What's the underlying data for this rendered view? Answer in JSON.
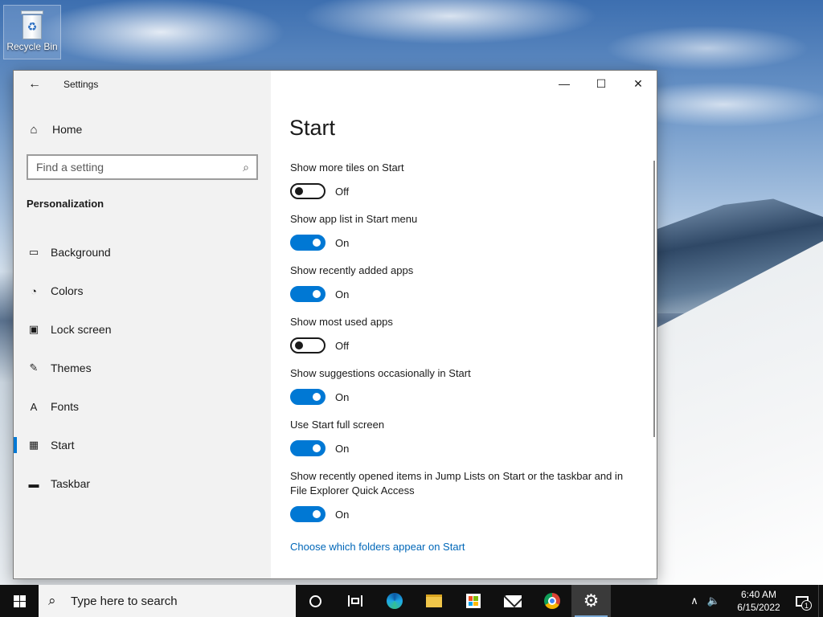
{
  "desktop": {
    "icons": [
      {
        "label": "Recycle Bin",
        "icon": "recycle-bin-icon"
      }
    ]
  },
  "window": {
    "app_title": "Settings",
    "caption": {
      "minimize": "—",
      "maximize": "☐",
      "close": "✕"
    },
    "sidebar": {
      "home_label": "Home",
      "search_placeholder": "Find a setting",
      "section_title": "Personalization",
      "items": [
        {
          "label": "Background",
          "icon": "background-icon",
          "glyph": "▭"
        },
        {
          "label": "Colors",
          "icon": "palette-icon",
          "glyph": "◔"
        },
        {
          "label": "Lock screen",
          "icon": "lock-screen-icon",
          "glyph": "▣"
        },
        {
          "label": "Themes",
          "icon": "themes-icon",
          "glyph": "✎"
        },
        {
          "label": "Fonts",
          "icon": "fonts-icon",
          "glyph": "A"
        },
        {
          "label": "Start",
          "icon": "start-icon",
          "glyph": "▦"
        },
        {
          "label": "Taskbar",
          "icon": "taskbar-icon",
          "glyph": "▬"
        }
      ],
      "active_item": "Start"
    },
    "content": {
      "title": "Start",
      "settings": [
        {
          "label": "Show more tiles on Start",
          "on": false,
          "state": "Off"
        },
        {
          "label": "Show app list in Start menu",
          "on": true,
          "state": "On"
        },
        {
          "label": "Show recently added apps",
          "on": true,
          "state": "On"
        },
        {
          "label": "Show most used apps",
          "on": false,
          "state": "Off"
        },
        {
          "label": "Show suggestions occasionally in Start",
          "on": true,
          "state": "On"
        },
        {
          "label": "Use Start full screen",
          "on": true,
          "state": "On"
        },
        {
          "label": "Show recently opened items in Jump Lists on Start or the taskbar and in File Explorer Quick Access",
          "on": true,
          "state": "On"
        }
      ],
      "link": "Choose which folders appear on Start"
    }
  },
  "taskbar": {
    "search_placeholder": "Type here to search",
    "pinned": [
      {
        "name": "cortana",
        "icon": "cortana-icon"
      },
      {
        "name": "task-view",
        "icon": "task-view-icon"
      },
      {
        "name": "edge",
        "icon": "edge-icon"
      },
      {
        "name": "file-explorer",
        "icon": "folder-icon"
      },
      {
        "name": "store",
        "icon": "store-icon"
      },
      {
        "name": "mail",
        "icon": "mail-icon"
      },
      {
        "name": "chrome",
        "icon": "chrome-icon"
      },
      {
        "name": "settings",
        "icon": "gear-icon",
        "active": true
      }
    ],
    "time": "6:40 AM",
    "date": "6/15/2022",
    "notification_count": "1"
  },
  "colors": {
    "accent": "#0078d4",
    "link": "#0067b8",
    "taskbar_bg": "#101010",
    "sidebar_bg": "#f2f2f2"
  }
}
